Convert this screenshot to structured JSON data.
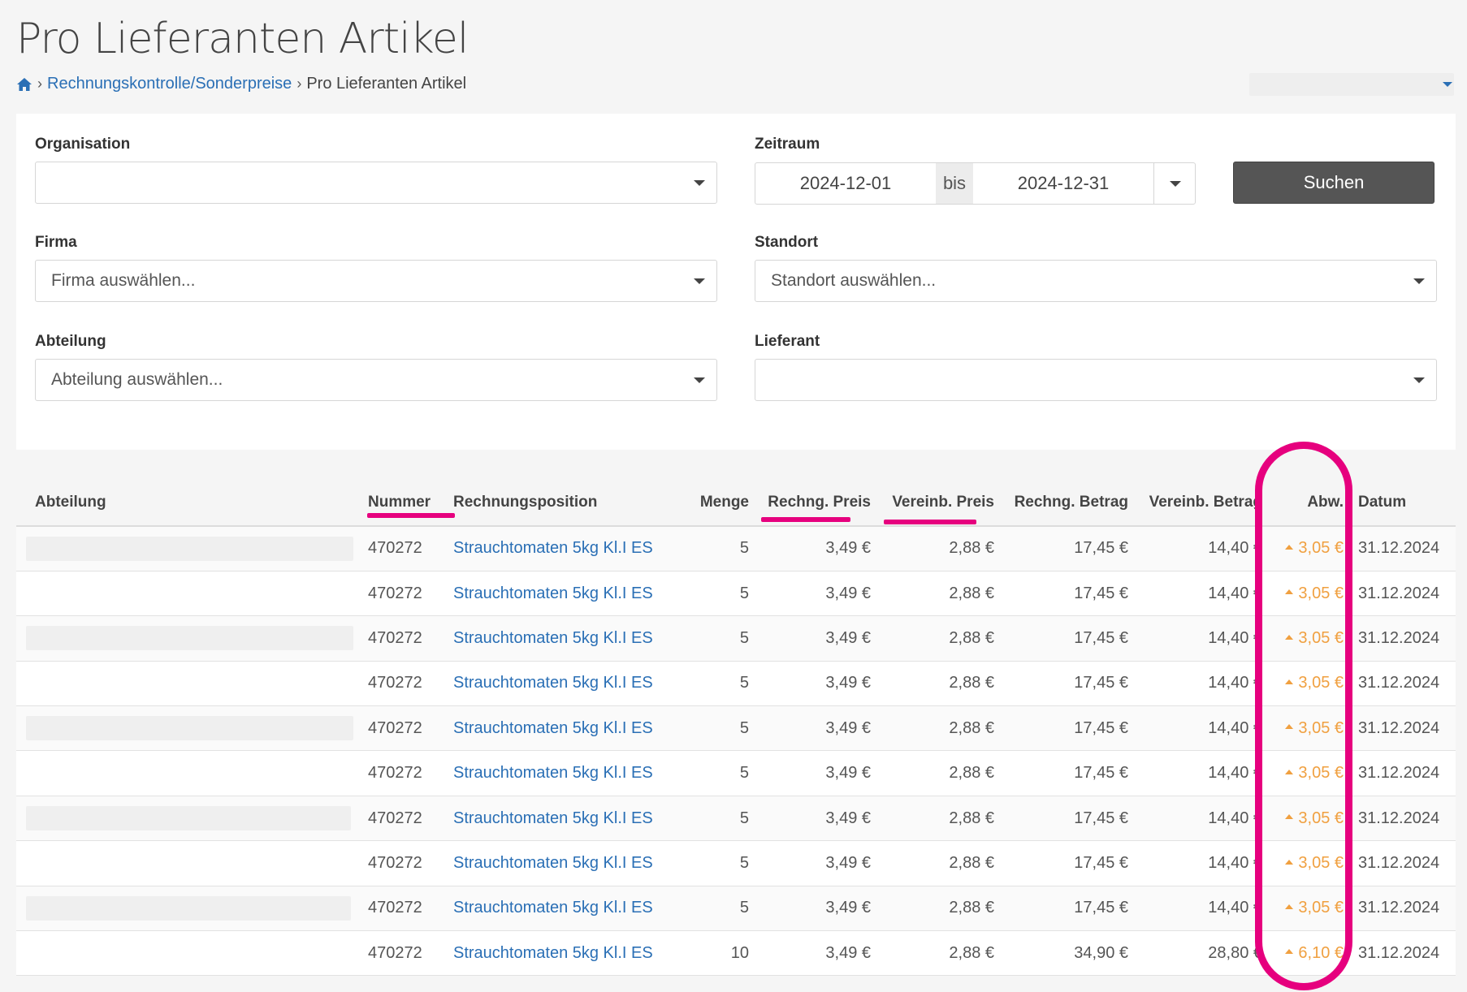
{
  "page": {
    "title": "Pro Lieferanten Artikel"
  },
  "breadcrumb": {
    "link": "Rechnungskontrolle/Sonderpreise",
    "current": "Pro Lieferanten Artikel",
    "separator": "›"
  },
  "filters": {
    "organisation_label": "Organisation",
    "organisation_value": "",
    "zeitraum_label": "Zeitraum",
    "date_from": "2024-12-01",
    "date_sep": "bis",
    "date_to": "2024-12-31",
    "search_button": "Suchen",
    "firma_label": "Firma",
    "firma_placeholder": "Firma auswählen...",
    "standort_label": "Standort",
    "standort_placeholder": "Standort auswählen...",
    "abteilung_label": "Abteilung",
    "abteilung_placeholder": "Abteilung auswählen...",
    "lieferant_label": "Lieferant",
    "lieferant_value": ""
  },
  "table": {
    "headers": [
      "Abteilung",
      "Nummer",
      "Rechnungsposition",
      "Menge",
      "Rechng. Preis",
      "Vereinb. Preis",
      "Rechng. Betrag",
      "Vereinb. Betrag",
      "Abw.",
      "Datum"
    ],
    "rows": [
      {
        "abteilung": "",
        "nummer": "470272",
        "position": "Strauchtomaten 5kg Kl.I ES",
        "menge": "5",
        "rechng_preis": "3,49 €",
        "vereinb_preis": "2,88 €",
        "rechng_betrag": "17,45 €",
        "vereinb_betrag": "14,40 €",
        "abw": "3,05 €",
        "datum": "31.12.2024"
      },
      {
        "abteilung": "",
        "nummer": "470272",
        "position": "Strauchtomaten 5kg Kl.I ES",
        "menge": "5",
        "rechng_preis": "3,49 €",
        "vereinb_preis": "2,88 €",
        "rechng_betrag": "17,45 €",
        "vereinb_betrag": "14,40 €",
        "abw": "3,05 €",
        "datum": "31.12.2024"
      },
      {
        "abteilung": "",
        "nummer": "470272",
        "position": "Strauchtomaten 5kg Kl.I ES",
        "menge": "5",
        "rechng_preis": "3,49 €",
        "vereinb_preis": "2,88 €",
        "rechng_betrag": "17,45 €",
        "vereinb_betrag": "14,40 €",
        "abw": "3,05 €",
        "datum": "31.12.2024"
      },
      {
        "abteilung": "",
        "nummer": "470272",
        "position": "Strauchtomaten 5kg Kl.I ES",
        "menge": "5",
        "rechng_preis": "3,49 €",
        "vereinb_preis": "2,88 €",
        "rechng_betrag": "17,45 €",
        "vereinb_betrag": "14,40 €",
        "abw": "3,05 €",
        "datum": "31.12.2024"
      },
      {
        "abteilung": "",
        "nummer": "470272",
        "position": "Strauchtomaten 5kg Kl.I ES",
        "menge": "5",
        "rechng_preis": "3,49 €",
        "vereinb_preis": "2,88 €",
        "rechng_betrag": "17,45 €",
        "vereinb_betrag": "14,40 €",
        "abw": "3,05 €",
        "datum": "31.12.2024"
      },
      {
        "abteilung": "",
        "nummer": "470272",
        "position": "Strauchtomaten 5kg Kl.I ES",
        "menge": "5",
        "rechng_preis": "3,49 €",
        "vereinb_preis": "2,88 €",
        "rechng_betrag": "17,45 €",
        "vereinb_betrag": "14,40 €",
        "abw": "3,05 €",
        "datum": "31.12.2024"
      },
      {
        "abteilung": "",
        "nummer": "470272",
        "position": "Strauchtomaten 5kg Kl.I ES",
        "menge": "5",
        "rechng_preis": "3,49 €",
        "vereinb_preis": "2,88 €",
        "rechng_betrag": "17,45 €",
        "vereinb_betrag": "14,40 €",
        "abw": "3,05 €",
        "datum": "31.12.2024"
      },
      {
        "abteilung": "",
        "nummer": "470272",
        "position": "Strauchtomaten 5kg Kl.I ES",
        "menge": "5",
        "rechng_preis": "3,49 €",
        "vereinb_preis": "2,88 €",
        "rechng_betrag": "17,45 €",
        "vereinb_betrag": "14,40 €",
        "abw": "3,05 €",
        "datum": "31.12.2024"
      },
      {
        "abteilung": "",
        "nummer": "470272",
        "position": "Strauchtomaten 5kg Kl.I ES",
        "menge": "5",
        "rechng_preis": "3,49 €",
        "vereinb_preis": "2,88 €",
        "rechng_betrag": "17,45 €",
        "vereinb_betrag": "14,40 €",
        "abw": "3,05 €",
        "datum": "31.12.2024"
      },
      {
        "abteilung": "",
        "nummer": "470272",
        "position": "Strauchtomaten 5kg Kl.I ES",
        "menge": "10",
        "rechng_preis": "3,49 €",
        "vereinb_preis": "2,88 €",
        "rechng_betrag": "34,90 €",
        "vereinb_betrag": "28,80 €",
        "abw": "6,10 €",
        "datum": "31.12.2024"
      }
    ]
  },
  "colors": {
    "link": "#2a6fb5",
    "deviation": "#f0a040",
    "highlight": "#e6007e",
    "button": "#555555"
  }
}
